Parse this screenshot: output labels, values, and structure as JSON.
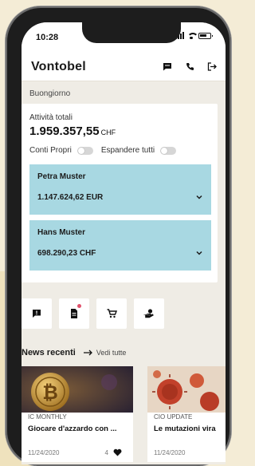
{
  "status_bar": {
    "time": "10:28"
  },
  "header": {
    "brand": "Vontobel"
  },
  "greeting": "Buongiorno",
  "summary": {
    "total_label": "Attività totali",
    "total_value": "1.959.357,55",
    "total_currency": "CHF",
    "toggle_1_label": "Conti Propri",
    "toggle_2_label": "Espandere tutti"
  },
  "accounts": [
    {
      "name": "Petra Muster",
      "value": "1.147.624,62 EUR"
    },
    {
      "name": "Hans Muster",
      "value": "698.290,23 CHF"
    }
  ],
  "actions": [
    {
      "icon": "message-alert-icon"
    },
    {
      "icon": "document-icon",
      "badge": true
    },
    {
      "icon": "cart-icon"
    },
    {
      "icon": "hand-money-icon"
    }
  ],
  "news": {
    "heading": "News recenti",
    "link": "Vedi tutte",
    "items": [
      {
        "tag": "IC MONTHLY",
        "title": "Giocare d'azzardo con ...",
        "date": "11/24/2020",
        "likes": "4"
      },
      {
        "tag": "CIO UPDATE",
        "title": "Le mutazioni vira",
        "date": "11/24/2020"
      }
    ]
  },
  "colors": {
    "account_tile": "#a8d8e2",
    "notification_badge": "#e0506b",
    "page_background": "#f4ecd6"
  }
}
